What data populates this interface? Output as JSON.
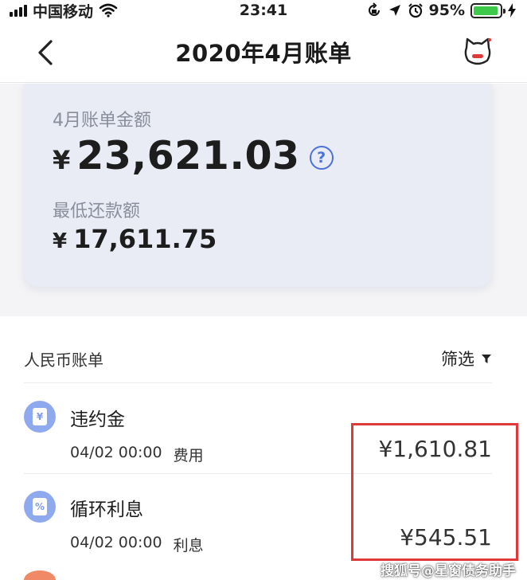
{
  "status_bar": {
    "carrier": "中国移动",
    "time": "23:41",
    "battery_percent": "95%",
    "battery_level": 0.95,
    "icons": [
      "signal-icon",
      "wifi-icon",
      "rotation-lock-icon",
      "location-icon",
      "alarm-icon",
      "battery-icon",
      "charging-icon"
    ]
  },
  "nav": {
    "title": "2020年4月账单",
    "back_icon": "chevron-left-icon",
    "right_icon": "cat-mascot-icon"
  },
  "summary": {
    "bill_label": "4月账单金额",
    "currency": "¥",
    "bill_amount": "23,621.03",
    "help_glyph": "?",
    "min_label": "最低还款额",
    "min_amount": "17,611.75"
  },
  "list": {
    "section_title": "人民币账单",
    "filter_label": "筛选",
    "items": [
      {
        "name": "违约金",
        "datetime": "04/02 00:00",
        "category": "费用",
        "amount": "¥1,610.81",
        "icon": "yen-document-icon",
        "icon_glyph": "¥"
      },
      {
        "name": "循环利息",
        "datetime": "04/02 00:00",
        "category": "利息",
        "amount": "¥545.51",
        "icon": "percent-document-icon",
        "icon_glyph": "%"
      }
    ]
  },
  "watermark": "搜狐号@星窗债务助手",
  "colors": {
    "card_bg": "#e9ebf5",
    "accent_blue": "#4a72d8",
    "icon_blue": "#8ea9ee",
    "highlight_red": "#e0393a",
    "battery_green": "#3ec94a"
  }
}
